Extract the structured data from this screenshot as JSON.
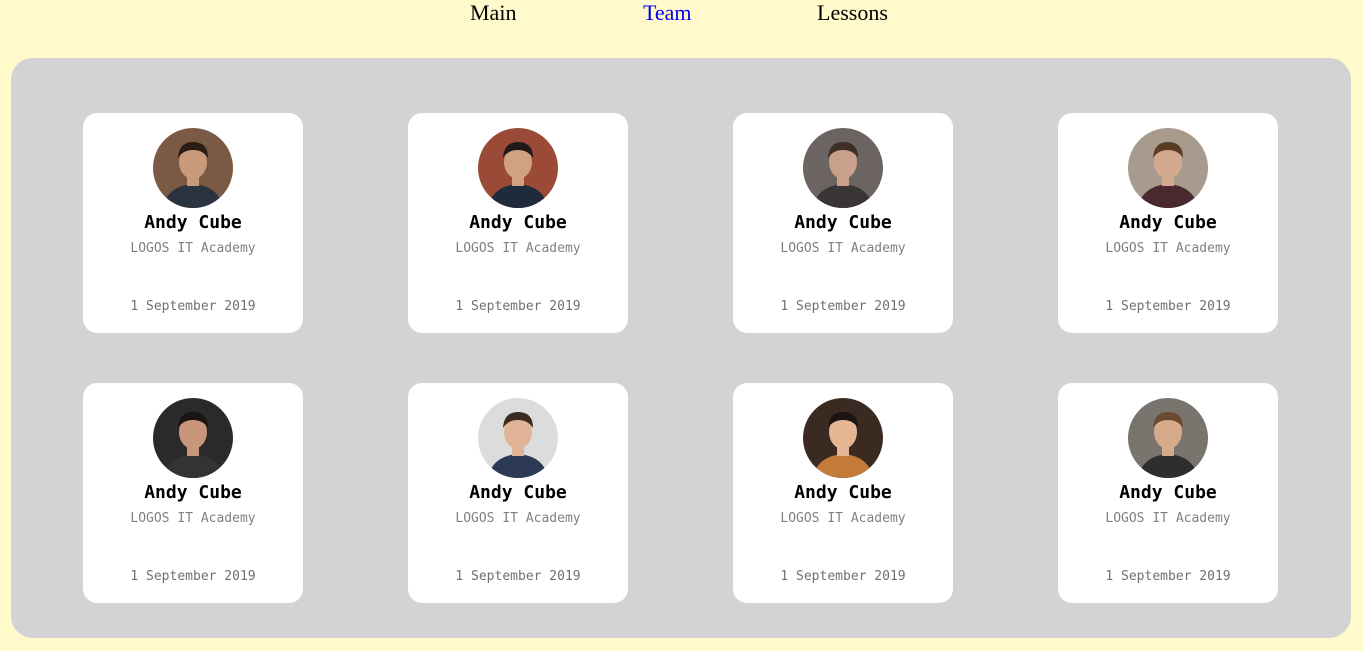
{
  "nav": {
    "items": [
      {
        "label": "Main",
        "active": false
      },
      {
        "label": "Team",
        "active": true
      },
      {
        "label": "Lessons",
        "active": false
      }
    ]
  },
  "colors": {
    "page_background": "#fff9cc",
    "panel_background": "#d3d3d3",
    "card_background": "#ffffff",
    "active_link": "#0000ee"
  },
  "team": {
    "cards": [
      {
        "name": "Andy Cube",
        "org": "LOGOS IT Academy",
        "date": "1 September 2019",
        "avatar": "person-photo-icon"
      },
      {
        "name": "Andy Cube",
        "org": "LOGOS IT Academy",
        "date": "1 September 2019",
        "avatar": "person-photo-icon"
      },
      {
        "name": "Andy Cube",
        "org": "LOGOS IT Academy",
        "date": "1 September 2019",
        "avatar": "person-photo-icon"
      },
      {
        "name": "Andy Cube",
        "org": "LOGOS IT Academy",
        "date": "1 September 2019",
        "avatar": "person-photo-icon"
      },
      {
        "name": "Andy Cube",
        "org": "LOGOS IT Academy",
        "date": "1 September 2019",
        "avatar": "person-photo-icon"
      },
      {
        "name": "Andy Cube",
        "org": "LOGOS IT Academy",
        "date": "1 September 2019",
        "avatar": "person-photo-icon"
      },
      {
        "name": "Andy Cube",
        "org": "LOGOS IT Academy",
        "date": "1 September 2019",
        "avatar": "person-photo-icon"
      },
      {
        "name": "Andy Cube",
        "org": "LOGOS IT Academy",
        "date": "1 September 2019",
        "avatar": "person-photo-icon"
      }
    ]
  }
}
